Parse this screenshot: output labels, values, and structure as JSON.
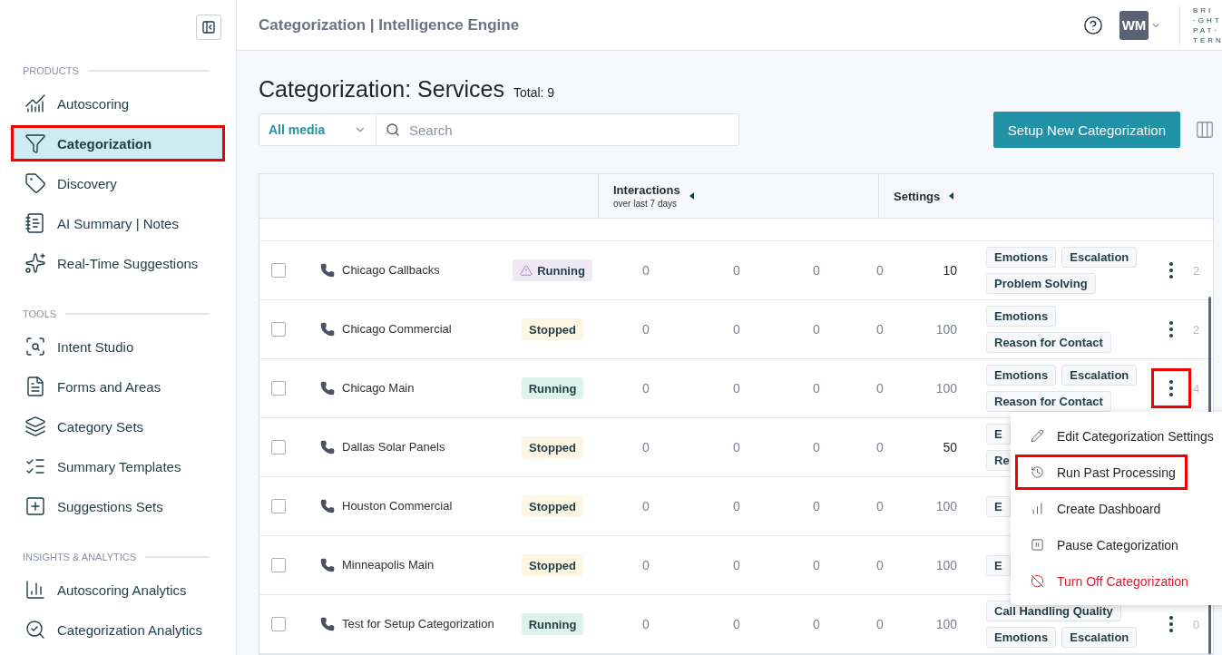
{
  "sidebar": {
    "sections": [
      {
        "title": "PRODUCTS",
        "items": [
          {
            "label": "Autoscoring",
            "selected": false,
            "highlighted": false
          },
          {
            "label": "Categorization",
            "selected": true,
            "highlighted": true
          },
          {
            "label": "Discovery",
            "selected": false,
            "highlighted": false
          },
          {
            "label": "AI Summary | Notes",
            "selected": false,
            "highlighted": false
          },
          {
            "label": "Real-Time Suggestions",
            "selected": false,
            "highlighted": false
          }
        ]
      },
      {
        "title": "TOOLS",
        "items": [
          {
            "label": "Intent Studio",
            "selected": false,
            "highlighted": false
          },
          {
            "label": "Forms and Areas",
            "selected": false,
            "highlighted": false
          },
          {
            "label": "Category Sets",
            "selected": false,
            "highlighted": false
          },
          {
            "label": "Summary Templates",
            "selected": false,
            "highlighted": false
          },
          {
            "label": "Suggestions Sets",
            "selected": false,
            "highlighted": false
          }
        ]
      },
      {
        "title": "INSIGHTS & ANALYTICS",
        "items": [
          {
            "label": "Autoscoring Analytics",
            "selected": false,
            "highlighted": false
          },
          {
            "label": "Categorization Analytics",
            "selected": false,
            "highlighted": false
          }
        ]
      }
    ]
  },
  "header": {
    "title": "Categorization | Intelligence Engine",
    "avatar": "WM",
    "logo": [
      "BRI",
      "·GHT",
      "PAT·",
      "TERN"
    ]
  },
  "page": {
    "title": "Categorization: Services",
    "total": "Total: 9",
    "media_filter": "All media",
    "search_placeholder": "Search",
    "setup_button": "Setup New Categorization"
  },
  "table": {
    "columns": [
      {
        "label": "Interactions",
        "sub": "over last 7 days"
      },
      {
        "label": "Settings"
      }
    ],
    "rows": [
      {
        "name": "Chicago Callbacks",
        "checked": false,
        "status": {
          "label": "Running",
          "kind": "running",
          "warning": true
        },
        "counts": [
          "0",
          "0",
          "0",
          "0"
        ],
        "threshold": "10",
        "emphasized": true,
        "tag_lines": [
          [
            "Emotions",
            "Escalation"
          ],
          [
            "Problem Solving"
          ]
        ],
        "menu_highlighted": false,
        "column_extra": "2"
      },
      {
        "name": "Chicago Commercial",
        "checked": false,
        "status": {
          "label": "Stopped",
          "kind": "stopped",
          "warning": false
        },
        "counts": [
          "0",
          "0",
          "0",
          "0"
        ],
        "threshold": "100",
        "emphasized": false,
        "tag_lines": [
          [
            "Emotions"
          ],
          [
            "Reason for Contact"
          ]
        ],
        "menu_highlighted": false,
        "column_extra": "2"
      },
      {
        "name": "Chicago Main",
        "checked": false,
        "status": {
          "label": "Running",
          "kind": "running",
          "warning": false
        },
        "counts": [
          "0",
          "0",
          "0",
          "0"
        ],
        "threshold": "100",
        "emphasized": false,
        "tag_lines": [
          [
            "Emotions",
            "Escalation"
          ],
          [
            "Reason for Contact"
          ]
        ],
        "menu_highlighted": true,
        "column_extra": "4"
      },
      {
        "name": "Dallas Solar Panels",
        "checked": false,
        "status": {
          "label": "Stopped",
          "kind": "stopped",
          "warning": false
        },
        "counts": [
          "0",
          "0",
          "0",
          "0"
        ],
        "threshold": "50",
        "emphasized": true,
        "tag_lines": [
          [
            "E"
          ],
          [
            "Re"
          ]
        ]
      },
      {
        "name": "Houston Commercial",
        "checked": false,
        "status": {
          "label": "Stopped",
          "kind": "stopped",
          "warning": false
        },
        "counts": [
          "0",
          "0",
          "0",
          "0"
        ],
        "threshold": "100",
        "emphasized": false,
        "tag_lines": [
          [
            "E"
          ]
        ]
      },
      {
        "name": "Minneapolis Main",
        "checked": false,
        "status": {
          "label": "Stopped",
          "kind": "stopped",
          "warning": false
        },
        "counts": [
          "0",
          "0",
          "0",
          "0"
        ],
        "threshold": "100",
        "emphasized": false,
        "tag_lines": [
          [
            "E"
          ]
        ]
      },
      {
        "name": "Test for Setup Categorization",
        "checked": false,
        "status": {
          "label": "Running",
          "kind": "running",
          "warning": false
        },
        "counts": [
          "0",
          "0",
          "0",
          "0"
        ],
        "threshold": "100",
        "emphasized": false,
        "tag_lines": [
          [
            "Call Handling Quality"
          ],
          [
            "Emotions",
            "Escalation"
          ]
        ],
        "menu_highlighted": false,
        "column_extra": "0"
      }
    ]
  },
  "menu": {
    "items": [
      {
        "label": "Edit Categorization Settings",
        "danger": false,
        "highlighted": false
      },
      {
        "label": "Run Past Processing",
        "danger": false,
        "highlighted": true
      },
      {
        "label": "Create Dashboard",
        "danger": false,
        "highlighted": false
      },
      {
        "label": "Pause Categorization",
        "danger": false,
        "highlighted": false
      },
      {
        "label": "Turn Off Categorization",
        "danger": true,
        "highlighted": false
      }
    ]
  }
}
